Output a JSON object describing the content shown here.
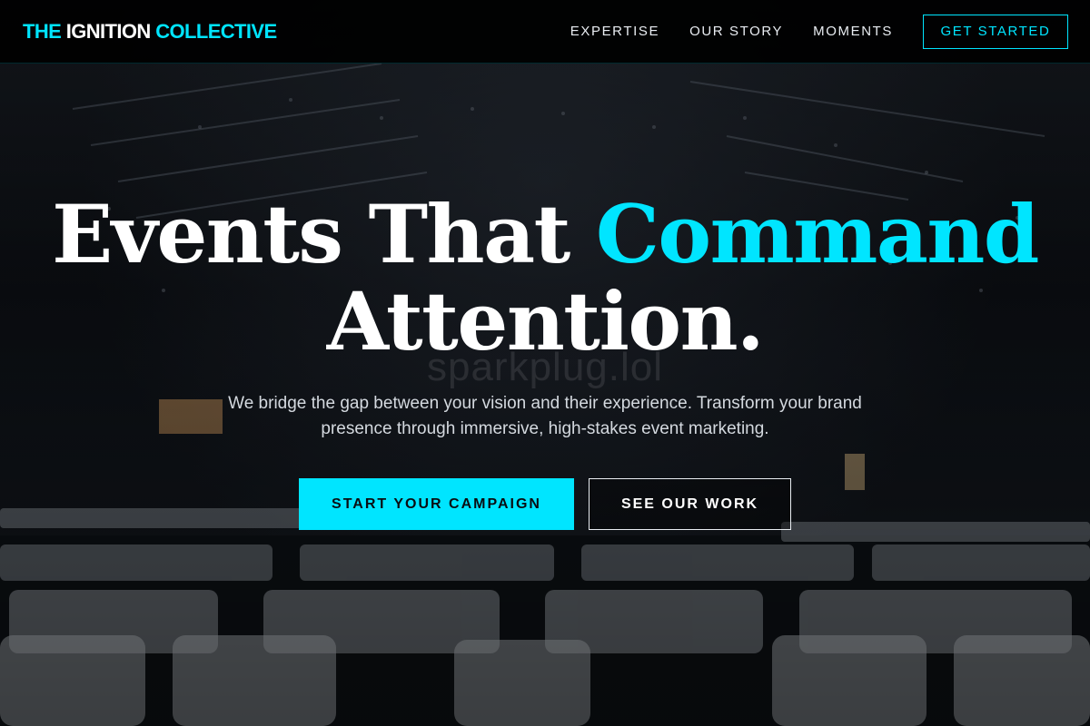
{
  "header": {
    "logo": {
      "part1": "THE ",
      "part2": "IGNITION",
      "part3": " COLLECTIVE"
    },
    "nav": [
      {
        "label": "EXPERTISE"
      },
      {
        "label": "OUR STORY"
      },
      {
        "label": "MOMENTS"
      }
    ],
    "cta_label": "GET STARTED"
  },
  "hero": {
    "headline_line1_a": "Events That ",
    "headline_line1_b": "Command",
    "headline_line2": "Attention.",
    "watermark": "sparkplug.lol",
    "subtitle": "We bridge the gap between your vision and their experience. Transform your brand presence through immersive, high-stakes event marketing.",
    "primary_button": "START YOUR CAMPAIGN",
    "secondary_button": "SEE OUR WORK"
  },
  "colors": {
    "accent": "#00e5ff",
    "background": "#05070a",
    "text": "#ffffff"
  }
}
